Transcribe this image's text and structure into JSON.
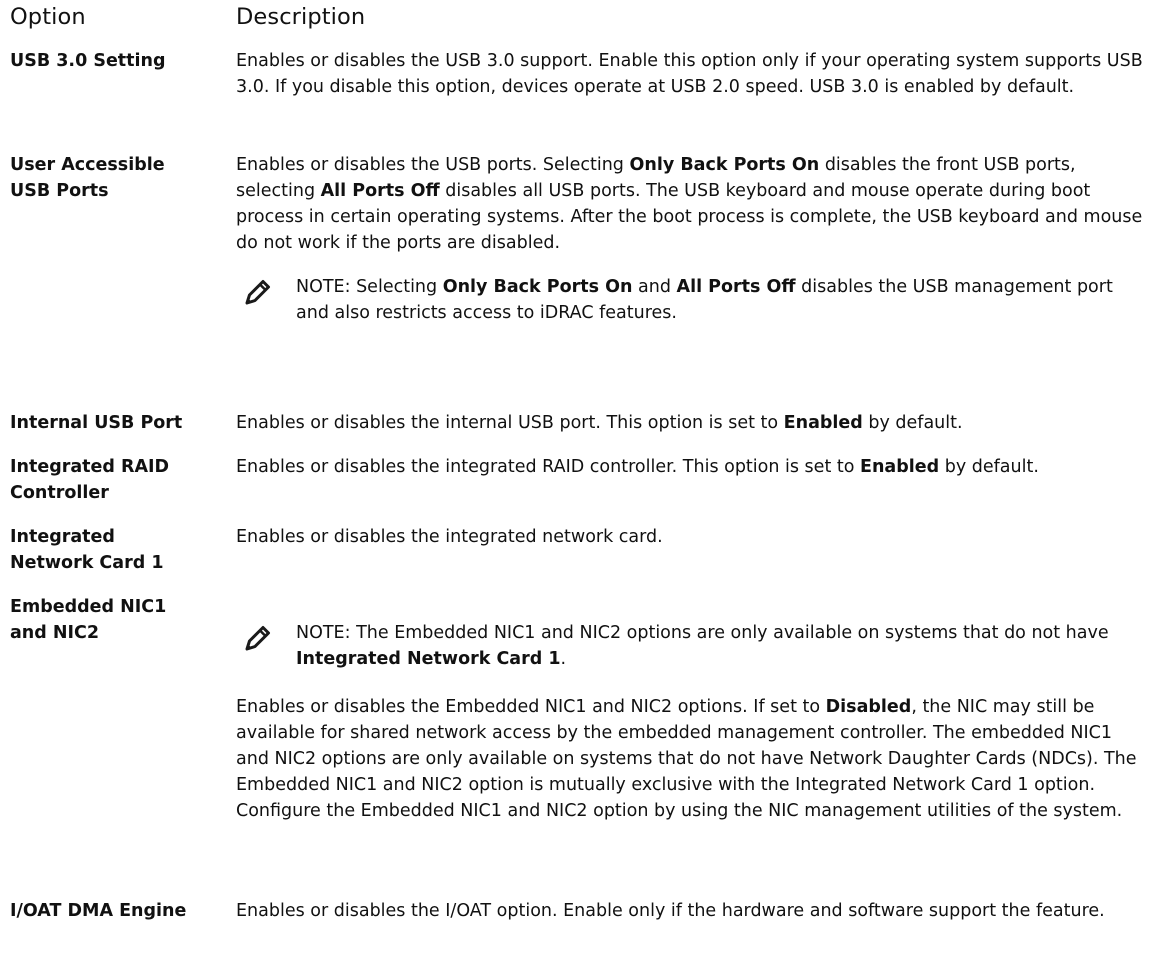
{
  "header": {
    "option": "Option",
    "description": "Description"
  },
  "rows": [
    {
      "term": "USB 3.0 Setting",
      "description": "Enables or disables the USB 3.0 support. Enable this option only if your operating system supports USB 3.0. If you disable this option, devices operate at USB 2.0 speed. USB 3.0 is enabled by default."
    },
    {
      "term_line1": "User Accessible",
      "term_line2": "USB Ports",
      "desc_p1": "Enables or disables the USB ports. Selecting ",
      "desc_b1": "Only Back Ports On",
      "desc_p2": " disables the front USB ports, selecting ",
      "desc_b2": "All Ports Off",
      "desc_p3": " disables all USB ports. The USB keyboard and mouse operate during boot process in certain operating systems. After the boot process is complete, the USB keyboard and mouse do not work if the ports are disabled.",
      "note": {
        "label": "NOTE:",
        "t1": " Selecting ",
        "b1": "Only Back Ports On",
        "t2": " and ",
        "b2": "All Ports Off",
        "t3": " disables the USB management port and also restricts access to iDRAC features."
      }
    },
    {
      "term": "Internal USB Port",
      "desc_p1": "Enables or disables the internal USB port. This option is set to ",
      "desc_b1": "Enabled",
      "desc_p2": " by default."
    },
    {
      "term_line1": "Integrated RAID",
      "term_line2": "Controller",
      "desc_p1": "Enables or disables the integrated RAID controller. This option is set to ",
      "desc_b1": "Enabled",
      "desc_p2": " by default."
    },
    {
      "term_line1": "Integrated",
      "term_line2": "Network Card 1",
      "description": "Enables or disables the integrated network card."
    },
    {
      "term_line1": "Embedded NIC1",
      "term_line2": "and NIC2",
      "note": {
        "label": "NOTE:",
        "t1": " The Embedded NIC1 and NIC2 options are only available on systems that do not have ",
        "b1": "Integrated Network Card 1",
        "t2": "."
      },
      "desc_p1": "Enables or disables the Embedded NIC1 and NIC2 options. If set to ",
      "desc_b1": "Disabled",
      "desc_p2": ", the NIC may still be available for shared network access by the embedded management controller. The embedded NIC1 and NIC2 options are only available on systems that do not have Network Daughter Cards (NDCs). The Embedded NIC1 and NIC2 option is mutually exclusive with the Integrated Network Card 1 option. Configure the Embedded NIC1 and NIC2 option by using the NIC management utilities of the system."
    },
    {
      "term": "I/OAT DMA Engine",
      "description": "Enables or disables the I/OAT option. Enable only if the hardware and software support the feature."
    }
  ],
  "icons": {
    "note": "pencil-note-icon"
  }
}
